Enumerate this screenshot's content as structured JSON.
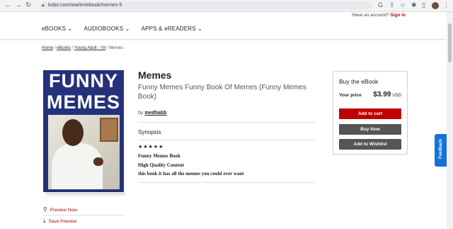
{
  "browser": {
    "url": "kobo.com/ww/en/ebook/memes-5"
  },
  "header": {
    "account_prompt": "Have an account?",
    "sign_in": "Sign in",
    "nav": [
      "eBOOKS",
      "AUDIOBOOKS",
      "APPS & eREADERS"
    ]
  },
  "breadcrumb": {
    "items": [
      "Home",
      "eBooks",
      "Young Adult - YA"
    ],
    "current": "Memes"
  },
  "book": {
    "cover_line1": "FUNNY",
    "cover_line2": "MEMES",
    "title": "Memes",
    "subtitle": "Funny Memes Funny Book Of Memes (Funny Memes Book)",
    "by_prefix": "by",
    "author": "medhabb",
    "synopsis_heading": "Synopsis",
    "stars": "★★★★★",
    "description": [
      "Funny Memes Book",
      "High Quality Content",
      "this book it has all the memes you could ever want"
    ]
  },
  "actions": {
    "preview": "Preview Now",
    "save": "Save Preview"
  },
  "buybox": {
    "title": "Buy the eBook",
    "price_label": "Your price",
    "price": "$3.99",
    "currency": "USD",
    "add_to_cart": "Add to cart",
    "buy_now": "Buy Now",
    "add_to_wishlist": "Add to Wishlist"
  },
  "feedback": "Feedback",
  "colors": {
    "accent_red": "#bf0000",
    "cover_blue": "#25317a",
    "button_gray": "#555555",
    "feedback_blue": "#1473d8"
  }
}
